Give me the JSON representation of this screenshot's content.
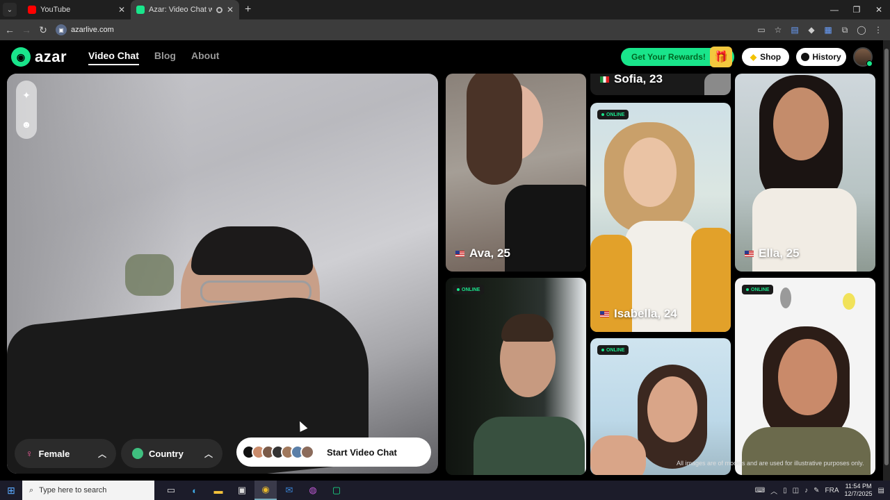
{
  "browser": {
    "tabs": [
      {
        "title": "YouTube",
        "favicon_color": "#ff0000",
        "active": false
      },
      {
        "title": "Azar: Video Chat with New",
        "favicon_color": "#19e58b",
        "active": true
      }
    ],
    "url": "azarlive.com"
  },
  "header": {
    "logo_text": "azar",
    "nav": [
      {
        "label": "Video Chat",
        "active": true
      },
      {
        "label": "Blog",
        "active": false
      },
      {
        "label": "About",
        "active": false
      }
    ],
    "rewards_label": "Get Your Rewards!",
    "shop_label": "Shop",
    "history_label": "History"
  },
  "controls": {
    "gender_label": "Female",
    "country_label": "Country",
    "start_label": "Start Video Chat"
  },
  "tiles": [
    {
      "name": "Ava, 25",
      "online": false,
      "flag": "us"
    },
    {
      "name": "Sofia, 23",
      "online": false,
      "flag": "it"
    },
    {
      "name": "Isabella, 24",
      "online": true,
      "flag": "us"
    },
    {
      "name": "Ella, 25",
      "online": false,
      "flag": "us"
    },
    {
      "name": "",
      "online": true
    },
    {
      "name": "",
      "online": true
    },
    {
      "name": "",
      "online": true
    }
  ],
  "online_badge": "ONLINE",
  "disclaimer": "All images are of models and are used for illustrative purposes only.",
  "taskbar": {
    "search_placeholder": "Type here to search",
    "language": "FRA",
    "time": "11:54 PM",
    "date": "12/7/2025"
  },
  "colors": {
    "brand": "#19e58b",
    "page_bg": "#000000"
  }
}
